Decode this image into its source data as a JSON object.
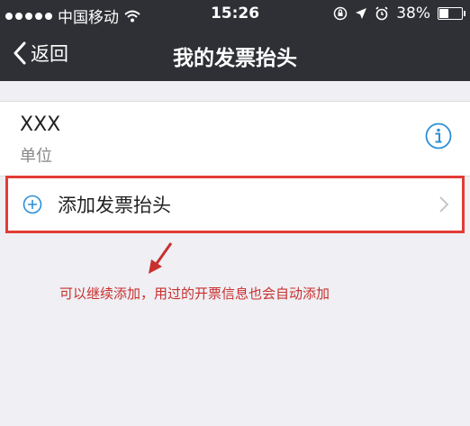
{
  "status_bar": {
    "carrier": "中国移动",
    "time": "15:26",
    "battery": "38%",
    "battery_level": 0.38
  },
  "nav": {
    "back_label": "返回",
    "title": "我的发票抬头"
  },
  "invoice_header": {
    "name": "XXX",
    "type": "单位"
  },
  "add_item": {
    "label": "添加发票抬头"
  },
  "annotation": {
    "text": "可以继续添加，用过的开票信息也会自动添加"
  },
  "colors": {
    "nav_bg": "#2e3035",
    "accent_blue": "#2a8fd8",
    "highlight_red": "#e23c36",
    "annotation_red": "#c8302d"
  }
}
